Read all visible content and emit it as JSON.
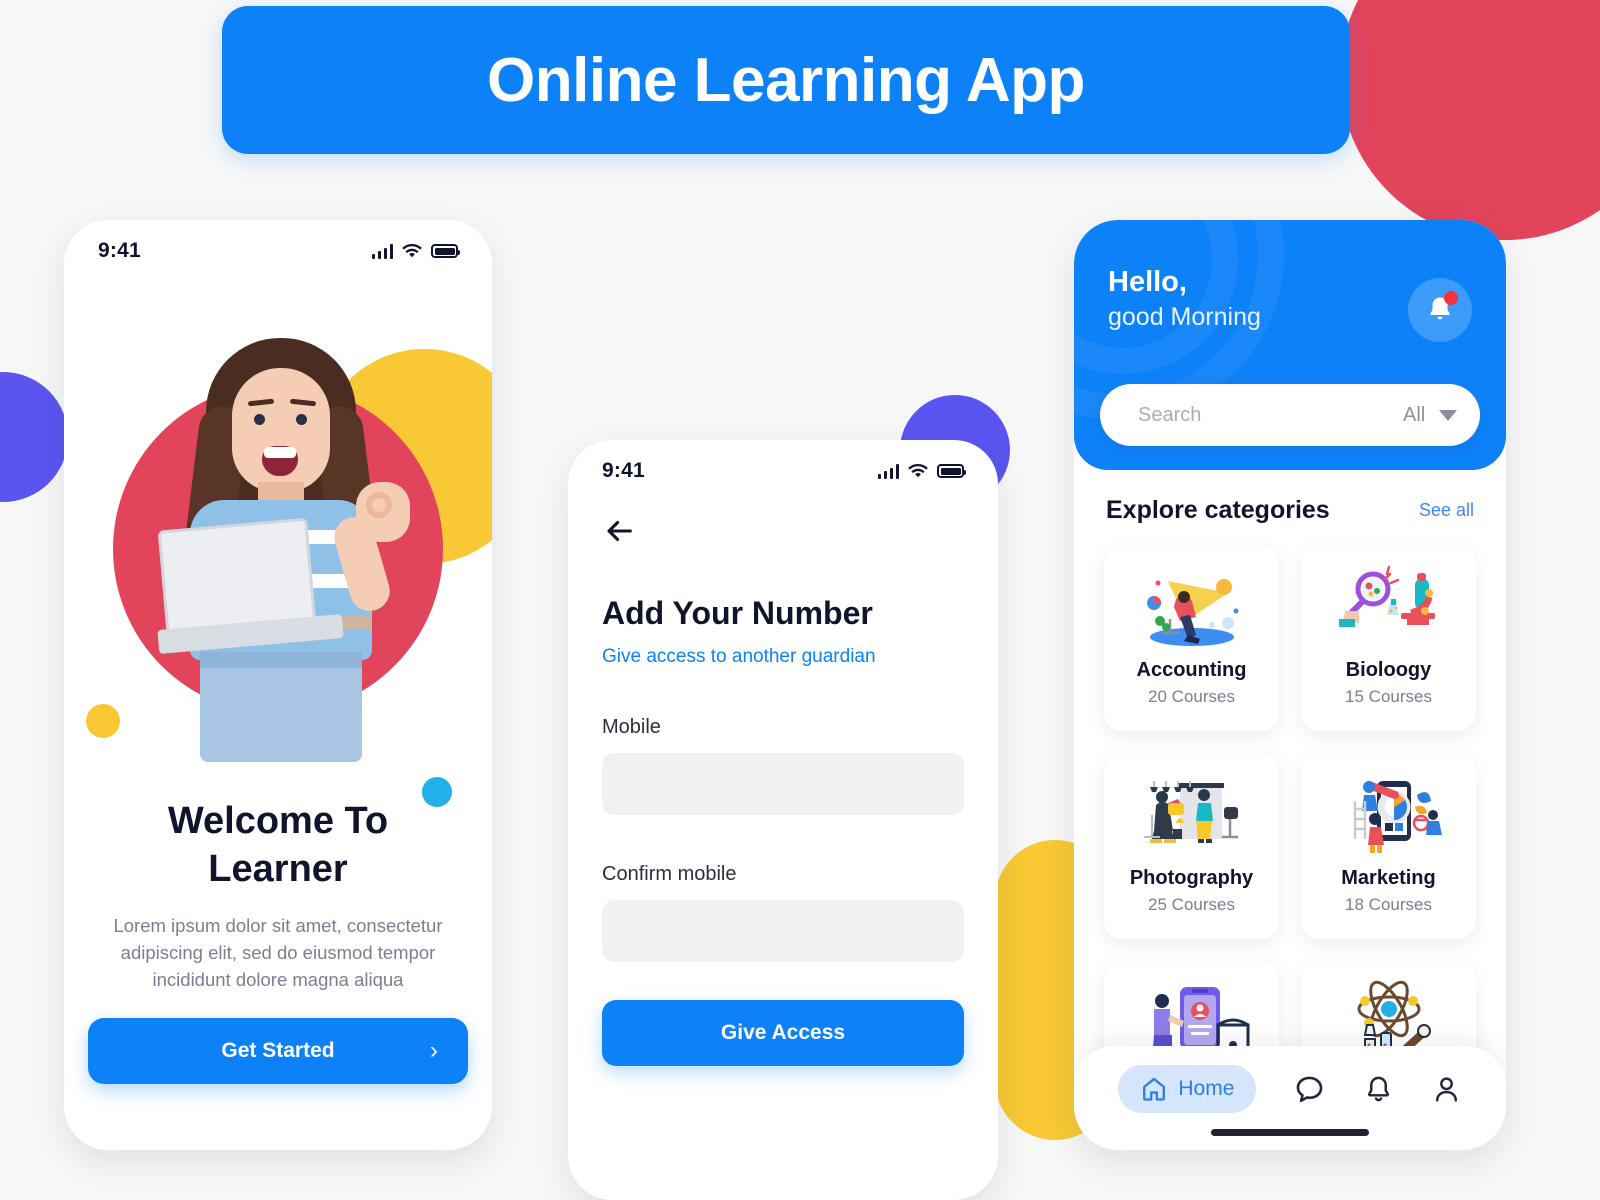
{
  "banner": {
    "title": "Online Learning App"
  },
  "colors": {
    "brand_blue": "#0d82f8",
    "red": "#e2445c",
    "yellow": "#f8c934",
    "purple": "#5a55f0",
    "cyan": "#22b0e8",
    "dark_text": "#11142d",
    "muted_text": "#7b7f91",
    "link_blue": "#4285f4",
    "badge_red": "#f2353c"
  },
  "screen_welcome": {
    "status": {
      "time": "9:41",
      "signal_icon": "signal-bars-icon",
      "wifi_icon": "wifi-icon",
      "battery_icon": "battery-icon"
    },
    "title_line1": "Welcome To",
    "title_line2": "Learner",
    "body": "Lorem ipsum dolor sit amet, consectetur adipiscing elit, sed do eiusmod tempor incididunt dolore magna aliqua",
    "cta_label": "Get Started",
    "cta_chevron": "chevron-right-icon"
  },
  "screen_add_number": {
    "status": {
      "time": "9:41",
      "signal_icon": "signal-bars-icon",
      "wifi_icon": "wifi-icon",
      "battery_icon": "battery-icon"
    },
    "back_icon": "arrow-left-icon",
    "title": "Add Your Number",
    "subtitle_link": "Give access to another guardian",
    "fields": [
      {
        "label": "Mobile",
        "value": "",
        "placeholder": ""
      },
      {
        "label": "Confirm mobile",
        "value": "",
        "placeholder": ""
      }
    ],
    "submit_label": "Give Access"
  },
  "screen_home": {
    "greeting_line1": "Hello,",
    "greeting_line2": "good Morning",
    "notification_icon": "bell-icon",
    "notification_badge": true,
    "search": {
      "icon": "search-icon",
      "placeholder": "Search",
      "value": "",
      "filter_label": "All",
      "filter_caret": "chevron-down-icon"
    },
    "section_title": "Explore categories",
    "section_link": "See all",
    "categories": [
      {
        "name": "Accounting",
        "count": "20 Courses",
        "illustration": "accounting-illustration"
      },
      {
        "name": "Bioloogy",
        "count": "15 Courses",
        "illustration": "biology-illustration"
      },
      {
        "name": "Photography",
        "count": "25 Courses",
        "illustration": "photography-illustration"
      },
      {
        "name": "Marketing",
        "count": "18 Courses",
        "illustration": "marketing-illustration"
      },
      {
        "name": "",
        "count": "",
        "illustration": "security-illustration"
      },
      {
        "name": "",
        "count": "",
        "illustration": "science-illustration"
      }
    ],
    "tabs": [
      {
        "label": "Home",
        "icon": "home-icon",
        "active": true
      },
      {
        "label": "",
        "icon": "chat-bubble-icon",
        "active": false
      },
      {
        "label": "",
        "icon": "bell-icon",
        "active": false
      },
      {
        "label": "",
        "icon": "person-icon",
        "active": false
      }
    ]
  }
}
